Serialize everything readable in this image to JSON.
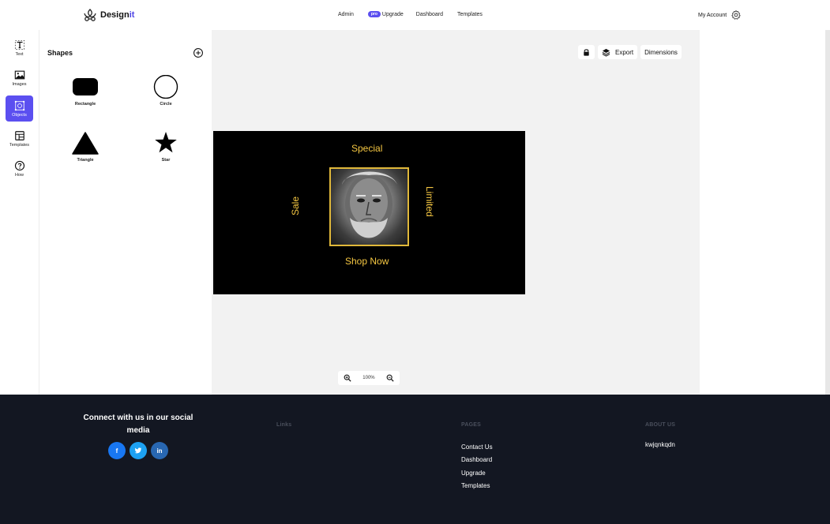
{
  "header": {
    "logo_text": "Design",
    "logo_accent": "it",
    "nav": {
      "admin": "Admin",
      "pro_badge": "pro",
      "upgrade": "Upgrade",
      "dashboard": "Dashboard",
      "templates": "Templates"
    },
    "account_label": "My Account"
  },
  "rail": {
    "items": [
      {
        "label": "Text",
        "icon": "text-icon"
      },
      {
        "label": "Images",
        "icon": "image-icon"
      },
      {
        "label": "Objects",
        "icon": "objects-icon",
        "active": true
      },
      {
        "label": "Templates",
        "icon": "templates-icon"
      },
      {
        "label": "How",
        "icon": "help-icon"
      }
    ]
  },
  "panel": {
    "title": "Shapes",
    "shapes": [
      {
        "label": "Rectangle",
        "icon": "rectangle-shape"
      },
      {
        "label": "Circle",
        "icon": "circle-shape"
      },
      {
        "label": "Triangle",
        "icon": "triangle-shape"
      },
      {
        "label": "Star",
        "icon": "star-shape"
      }
    ]
  },
  "toolbar": {
    "export": "Export",
    "dimensions": "Dimensions"
  },
  "canvas": {
    "special": "Special",
    "sale": "Sale",
    "limited": "Limited",
    "shop_now": "Shop Now",
    "text_color": "#f5c742"
  },
  "zoom": {
    "level": "100%"
  },
  "footer": {
    "social_title": "Connect with us in our social media",
    "links_head": "Links",
    "pages_head": "PAGES",
    "pages": [
      "Contact Us",
      "Dashboard",
      "Upgrade",
      "Templates"
    ],
    "about_head": "ABOUT US",
    "about_text": "kwjqnkqdn"
  },
  "colors": {
    "accent": "#5b4ff0",
    "footer_bg": "#131722",
    "facebook": "#1877f2",
    "twitter": "#1da1f2",
    "linkedin": "#2867b2"
  }
}
